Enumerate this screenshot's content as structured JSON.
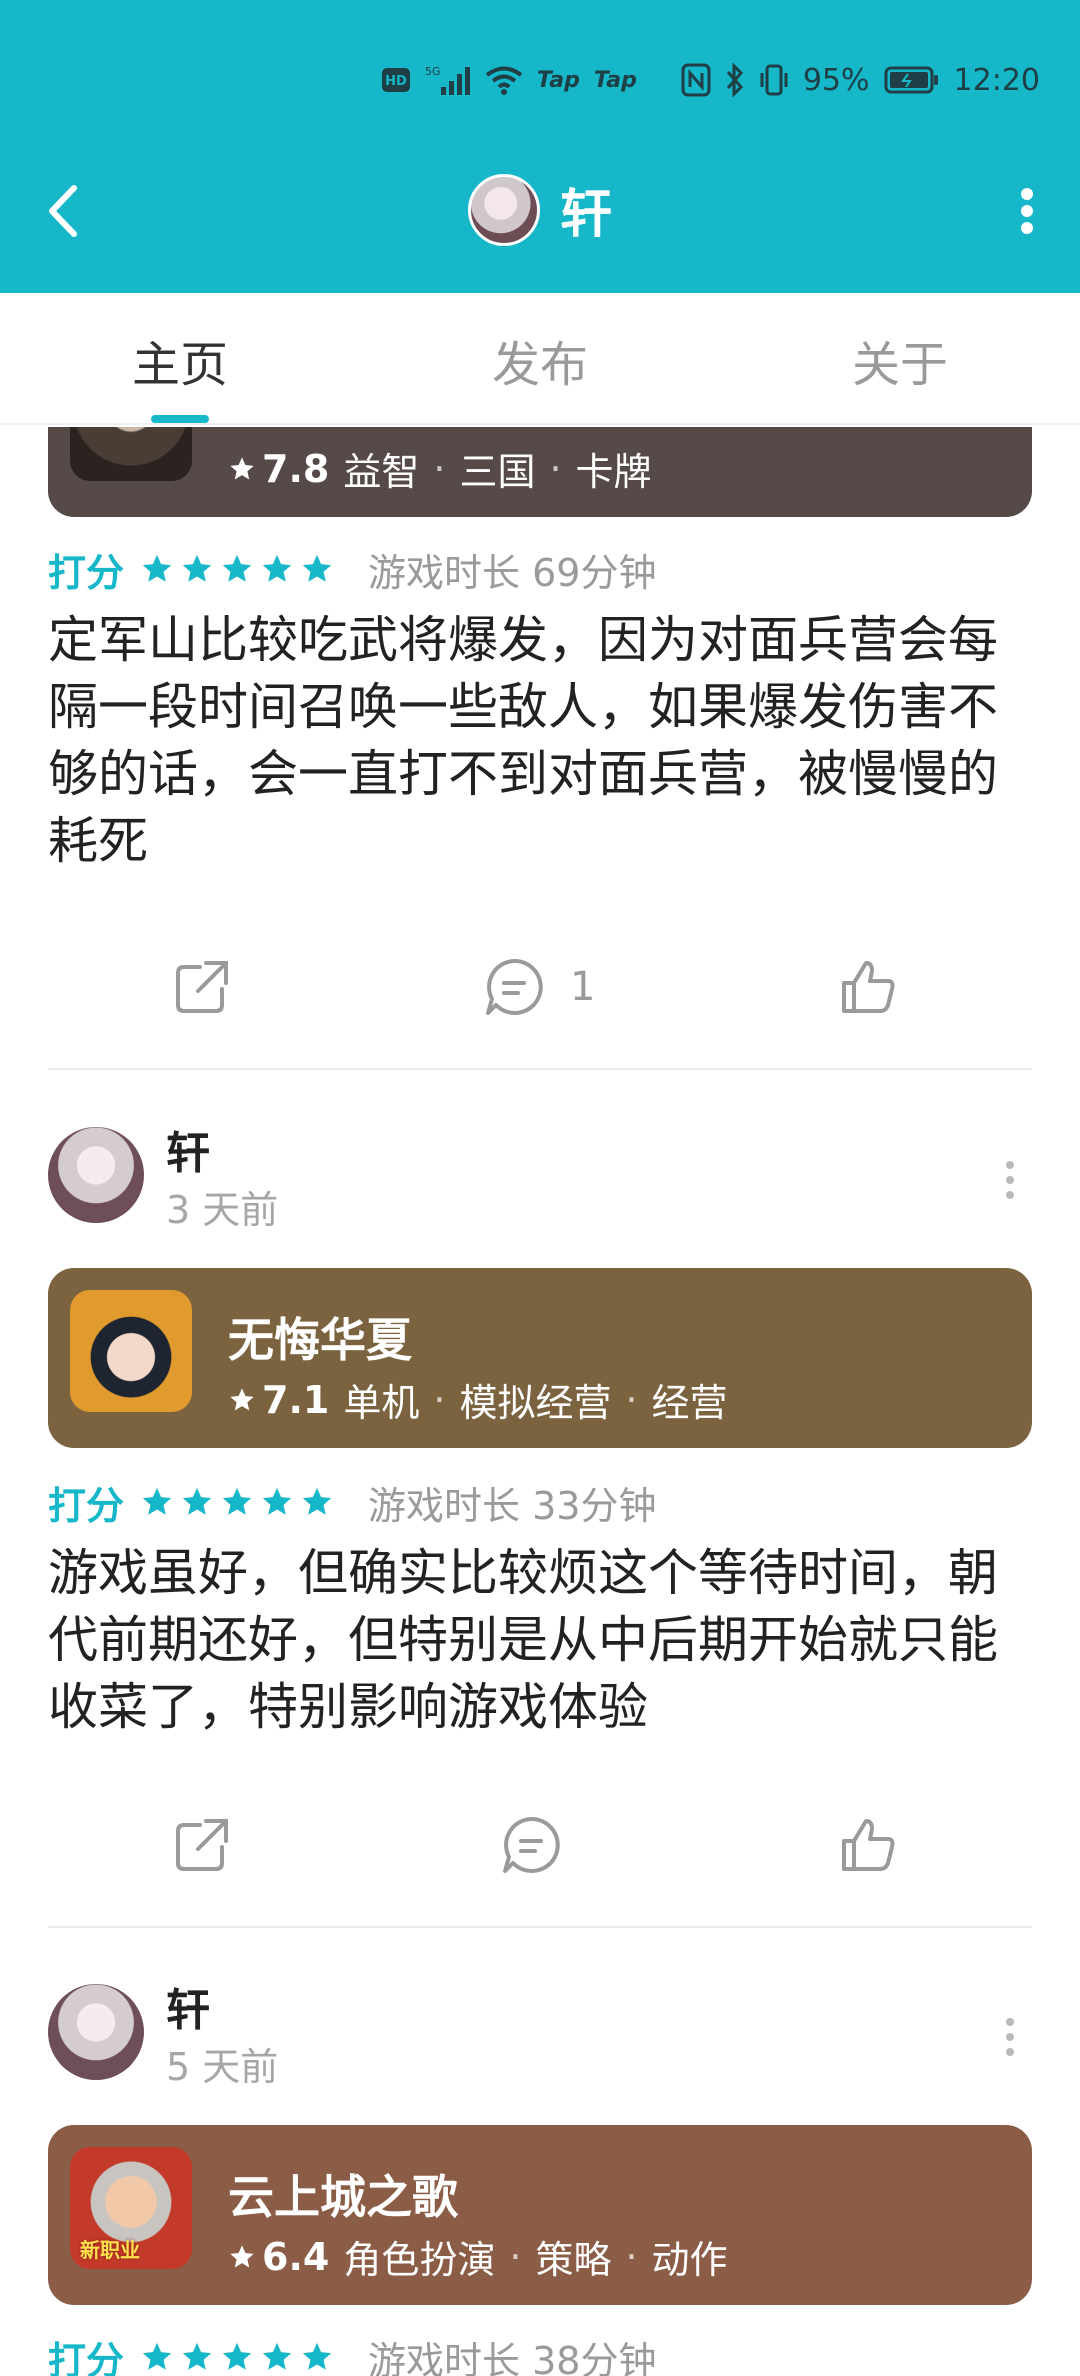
{
  "status_bar": {
    "hd": "HD",
    "network": "5G",
    "tap1": "Tap",
    "tap2": "Tap",
    "battery": "95%",
    "time": "12:20"
  },
  "header": {
    "title": "轩",
    "back_icon": "chevron-left-icon",
    "more_icon": "more-vertical-icon"
  },
  "tabs": [
    {
      "label": "主页",
      "active": true
    },
    {
      "label": "发布",
      "active": false
    },
    {
      "label": "关于",
      "active": false
    }
  ],
  "colors": {
    "accent": "#16b7c8",
    "card1": "#564a48",
    "card2": "#7c6340",
    "card3": "#8b5d46"
  },
  "posts": [
    {
      "game": {
        "name": "",
        "rating": "7.8",
        "tags": [
          "益智",
          "三国",
          "卡牌"
        ]
      },
      "rate_label": "打分",
      "stars": 5,
      "duration": "游戏时长 69分钟",
      "text": "定军山比较吃武将爆发，因为对面兵营会每隔一段时间召唤一些敌人，如果爆发伤害不够的话，会一直打不到对面兵营，被慢慢的耗死",
      "comment_count": "1"
    },
    {
      "user": {
        "name": "轩",
        "time": "3 天前"
      },
      "game": {
        "name": "无悔华夏",
        "rating": "7.1",
        "tags": [
          "单机",
          "模拟经营",
          "经营"
        ]
      },
      "rate_label": "打分",
      "stars": 5,
      "duration": "游戏时长 33分钟",
      "text": "游戏虽好，但确实比较烦这个等待时间，朝代前期还好，但特别是从中后期开始就只能收菜了，特别影响游戏体验",
      "comment_count": ""
    },
    {
      "user": {
        "name": "轩",
        "time": "5 天前"
      },
      "game": {
        "name": "云上城之歌",
        "rating": "6.4",
        "tags": [
          "角色扮演",
          "策略",
          "动作"
        ],
        "icon_badge": "新职业"
      },
      "rate_label": "打分",
      "stars": 5,
      "duration": "游戏时长 38分钟"
    }
  ]
}
